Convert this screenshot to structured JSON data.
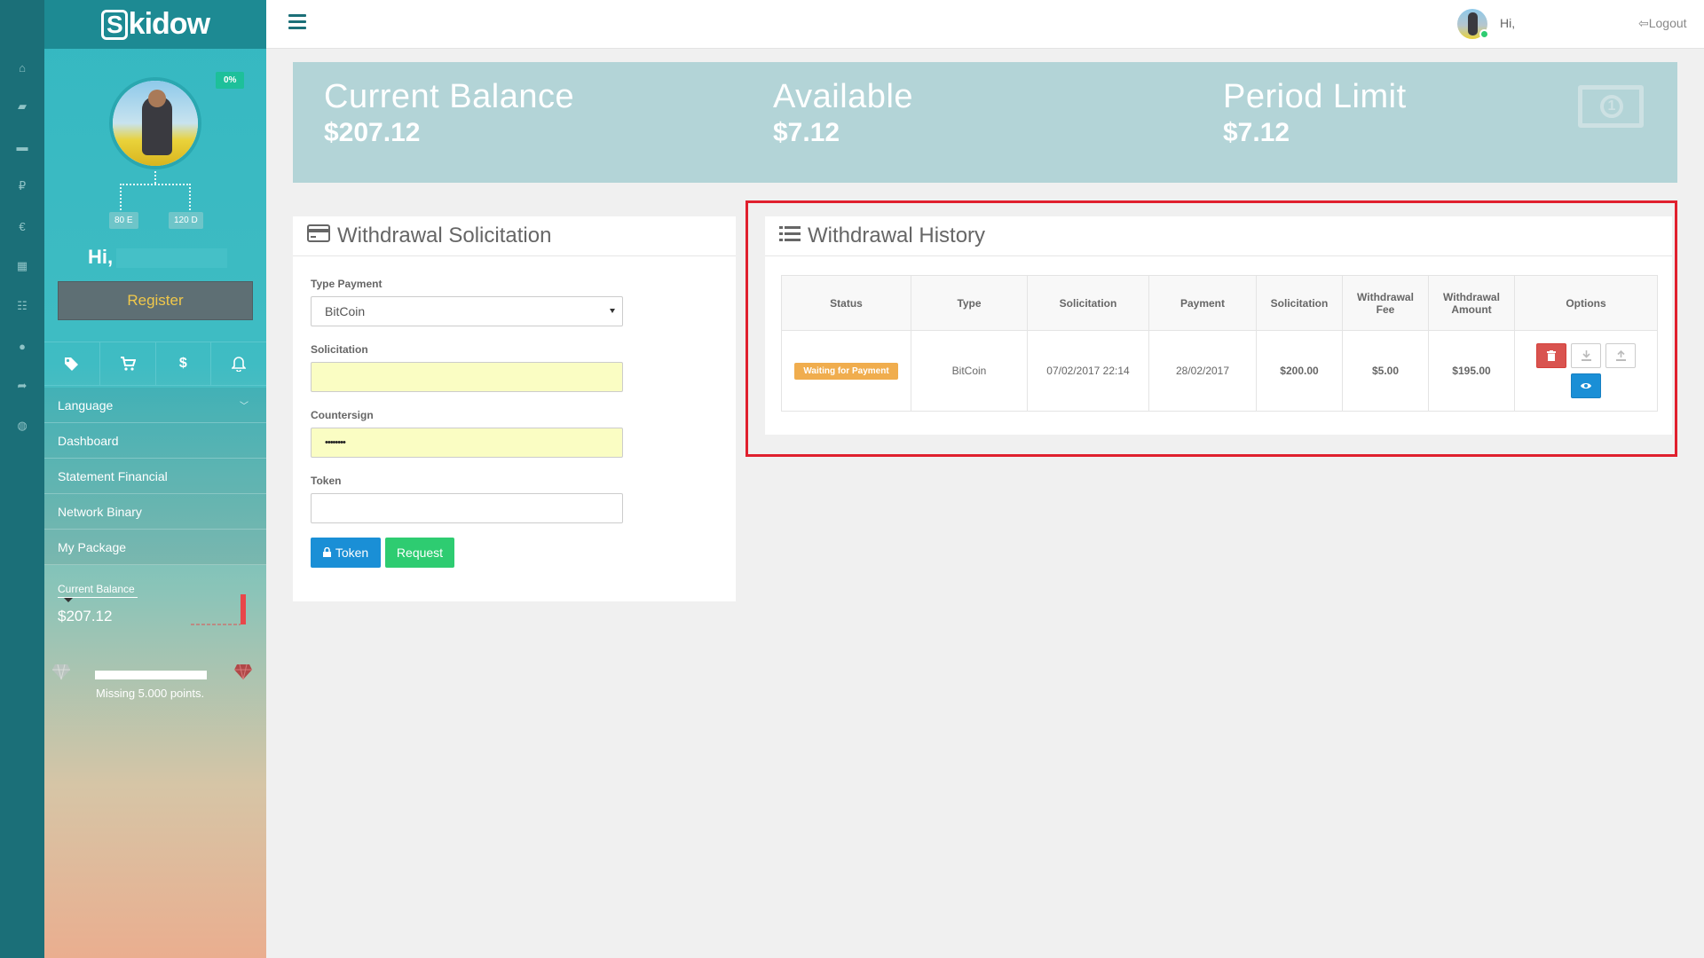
{
  "brand": {
    "logo_letter": "S",
    "logo_rest": "kidow"
  },
  "sidebar": {
    "progress_badge": "0%",
    "node_left": "80 E",
    "node_right": "120 D",
    "greeting": "Hi,",
    "register_label": "Register",
    "quick_icons": [
      "tags-icon",
      "cart-icon",
      "dollar-icon",
      "bell-icon"
    ],
    "menu": [
      {
        "label": "Language",
        "has_chevron": true
      },
      {
        "label": "Dashboard"
      },
      {
        "label": "Statement Financial"
      },
      {
        "label": "Network Binary"
      },
      {
        "label": "My Package"
      }
    ],
    "current_balance_label": "Current Balance",
    "current_balance_value": "$207.12",
    "points_progress": 0,
    "missing_points_text": "Missing 5.000 points."
  },
  "rail_icons": [
    "home-icon",
    "folder-icon",
    "briefcase-icon",
    "ruble-icon",
    "euro-icon",
    "calculator-icon",
    "grid-icon",
    "users-icon",
    "share-icon",
    "globe-icon"
  ],
  "header": {
    "greeting": "Hi,",
    "logout_label": "Logout"
  },
  "banner": {
    "stats": [
      {
        "label": "Current Balance",
        "value": "$207.12"
      },
      {
        "label": "Available",
        "value": "$7.12"
      },
      {
        "label": "Period Limit",
        "value": "$7.12"
      }
    ]
  },
  "solicitation_form": {
    "title": "Withdrawal Solicitation",
    "type_payment_label": "Type Payment",
    "type_payment_value": "BitCoin",
    "solicitation_label": "Solicitation",
    "solicitation_value": "",
    "countersign_label": "Countersign",
    "countersign_value": "••••••••",
    "token_label": "Token",
    "token_value": "",
    "token_button": "Token",
    "request_button": "Request"
  },
  "history": {
    "title": "Withdrawal History",
    "columns": [
      "Status",
      "Type",
      "Solicitation",
      "Payment",
      "Solicitation",
      "Withdrawal Fee",
      "Withdrawal Amount",
      "Options"
    ],
    "rows": [
      {
        "status": "Waiting for Payment",
        "type": "BitCoin",
        "solicitation_date": "07/02/2017 22:14",
        "payment_date": "28/02/2017",
        "solicitation_amount": "$200.00",
        "fee": "$5.00",
        "amount": "$195.00"
      }
    ]
  },
  "colors": {
    "rail": "#1b6f78",
    "banner": "#b3d4d7",
    "highlight_border": "#e0202e",
    "waiting_badge": "#f0ad4e",
    "token_button": "#1a8fd6",
    "request_button": "#2ecc71",
    "delete_button": "#d9534f"
  }
}
